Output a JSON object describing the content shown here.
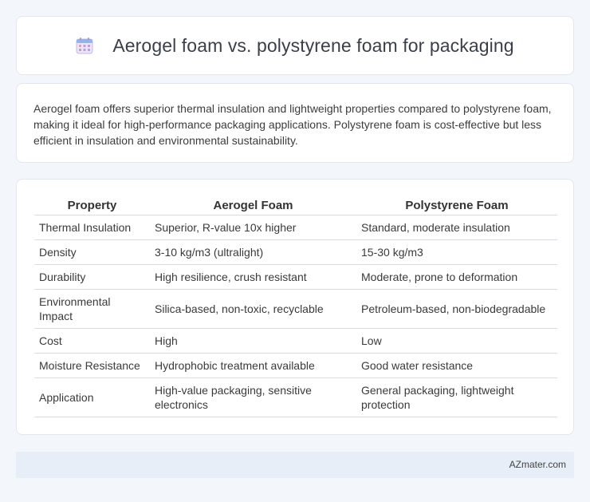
{
  "header": {
    "title": "Aerogel foam vs. polystyrene foam for packaging",
    "icon": "calendar-icon"
  },
  "summary": {
    "text": "Aerogel foam offers superior thermal insulation and lightweight properties compared to polystyrene foam, making it ideal for high-performance packaging applications. Polystyrene foam is cost-effective but less efficient in insulation and environmental sustainability."
  },
  "table": {
    "headers": [
      "Property",
      "Aerogel Foam",
      "Polystyrene Foam"
    ],
    "rows": [
      [
        "Thermal Insulation",
        "Superior, R-value 10x higher",
        "Standard, moderate insulation"
      ],
      [
        "Density",
        "3-10 kg/m3 (ultralight)",
        "15-30 kg/m3"
      ],
      [
        "Durability",
        "High resilience, crush resistant",
        "Moderate, prone to deformation"
      ],
      [
        "Environmental Impact",
        "Silica-based, non-toxic, recyclable",
        "Petroleum-based, non-biodegradable"
      ],
      [
        "Cost",
        "High",
        "Low"
      ],
      [
        "Moisture Resistance",
        "Hydrophobic treatment available",
        "Good water resistance"
      ],
      [
        "Application",
        "High-value packaging, sensitive electronics",
        "General packaging, lightweight protection"
      ]
    ]
  },
  "footer": {
    "text": "AZmater.com"
  },
  "colors": {
    "background": "#f3f6fb",
    "card": "#ffffff",
    "footer": "#e8eef8",
    "icon_accent": "#c9b6e8"
  }
}
